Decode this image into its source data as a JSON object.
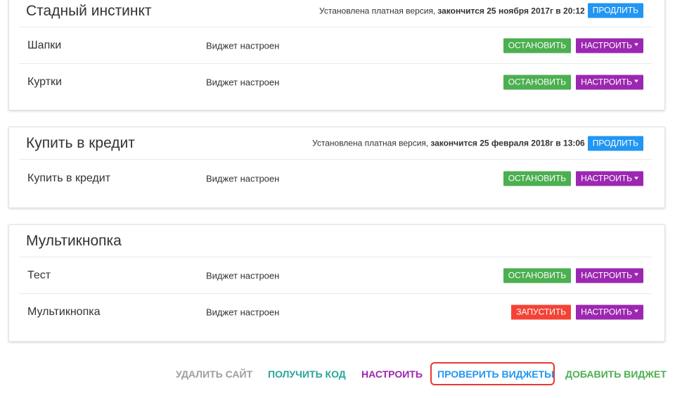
{
  "colors": {
    "primary_blue": "#2196f3",
    "green": "#4caf50",
    "red": "#f44336",
    "purple": "#9c27b0",
    "teal": "#26a69a",
    "grey": "#9e9e9e",
    "highlight_border": "#e53935"
  },
  "cards": [
    {
      "title": "Стадный инстинкт",
      "license_prefix": "Установлена платная версия,",
      "license_expiry": "закончится 25 ноября 2017г в 20:12",
      "extend_label": "ПРОДЛИТЬ",
      "rows": [
        {
          "name": "Шапки",
          "status": "Виджет настроен",
          "action_label": "ОСТАНОВИТЬ",
          "action_type": "stop",
          "configure_label": "НАСТРОИТЬ"
        },
        {
          "name": "Куртки",
          "status": "Виджет настроен",
          "action_label": "ОСТАНОВИТЬ",
          "action_type": "stop",
          "configure_label": "НАСТРОИТЬ"
        }
      ]
    },
    {
      "title": "Купить в кредит",
      "license_prefix": "Установлена платная версия,",
      "license_expiry": "закончится 25 февраля 2018г в 13:06",
      "extend_label": "ПРОДЛИТЬ",
      "rows": [
        {
          "name": "Купить в кредит",
          "status": "Виджет настроен",
          "action_label": "ОСТАНОВИТЬ",
          "action_type": "stop",
          "configure_label": "НАСТРОИТЬ"
        }
      ]
    },
    {
      "title": "Мультикнопка",
      "rows": [
        {
          "name": "Тест",
          "status": "Виджет настроен",
          "action_label": "ОСТАНОВИТЬ",
          "action_type": "stop",
          "configure_label": "НАСТРОИТЬ"
        },
        {
          "name": "Мультикнопка",
          "status": "Виджет настроен",
          "action_label": "ЗАПУСТИТЬ",
          "action_type": "start",
          "configure_label": "НАСТРОИТЬ"
        }
      ]
    }
  ],
  "footer": {
    "delete_site": "УДАЛИТЬ САЙТ",
    "get_code": "ПОЛУЧИТЬ КОД",
    "configure": "НАСТРОИТЬ",
    "check_widgets": "ПРОВЕРИТЬ ВИДЖЕТЫ",
    "add_widget": "ДОБАВИТЬ ВИДЖЕТ"
  }
}
